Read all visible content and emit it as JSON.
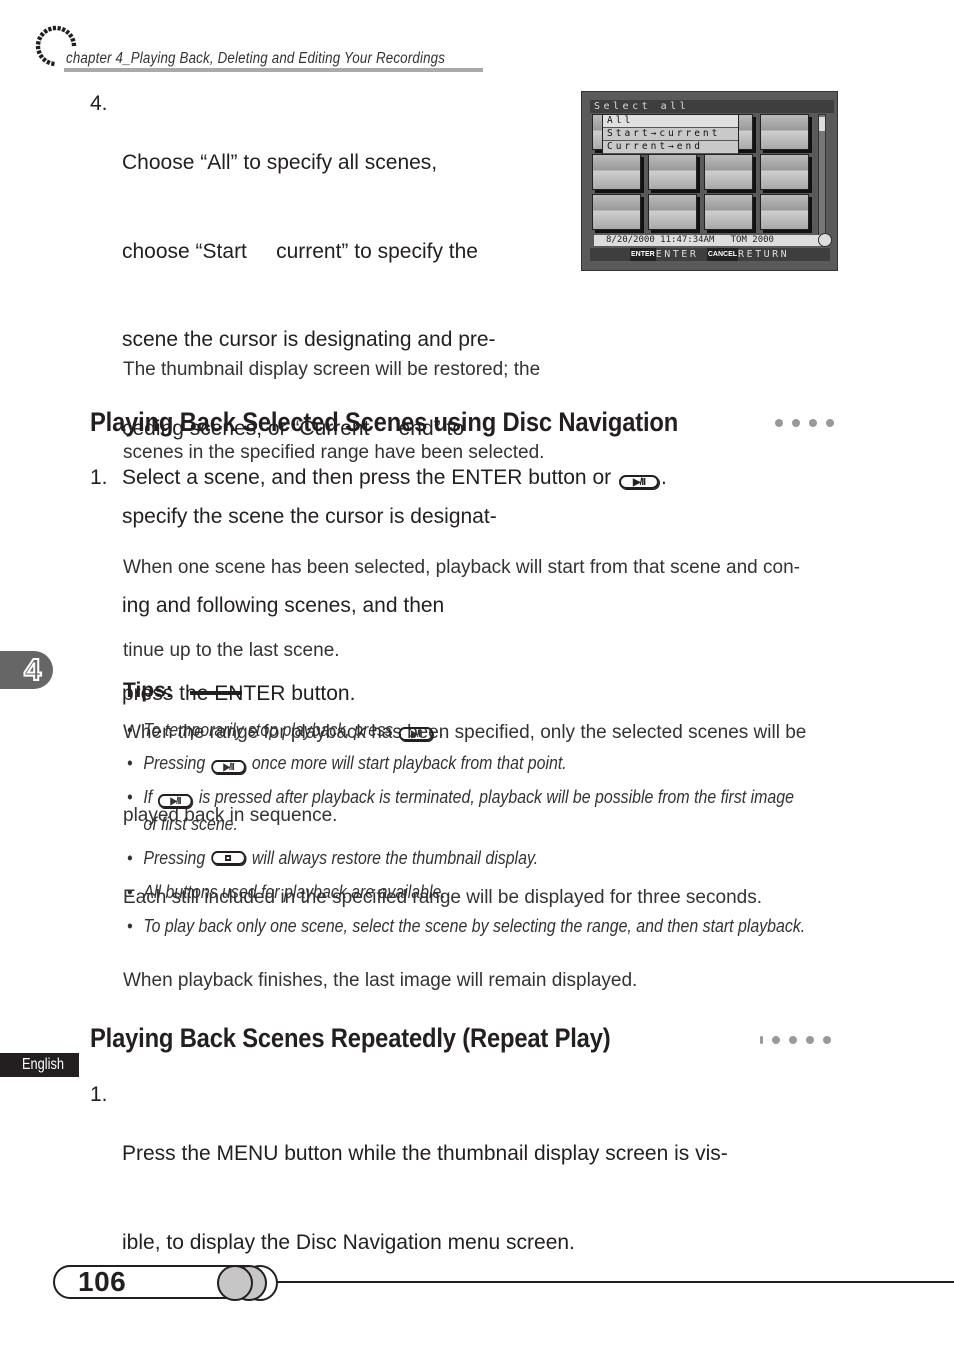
{
  "header": {
    "chapter_title": "chapter 4_Playing Back, Deleting and Editing Your Recordings"
  },
  "step4": {
    "number": "4.",
    "lines": [
      "Choose “All” to specify all scenes,",
      "choose “Start     current” to specify the",
      "scene the cursor is designating and pre-",
      "ceding scenes, or “Current     end” to",
      "specify the scene the cursor is designat-",
      "ing and following scenes, and then",
      "press the ENTER button."
    ],
    "note_lines": [
      "The thumbnail display screen will be restored; the",
      "scenes in the specified range have been selected."
    ]
  },
  "screen": {
    "title": "Select all",
    "menu_items": [
      "All",
      "Start→current",
      "Current→end"
    ],
    "selected_index": 0,
    "info": "8/20/2000 11:47:34AM   TOM 2000",
    "enter_tag": "ENTER",
    "enter_label": "ENTER",
    "cancel_tag": "CANCEL",
    "cancel_label": "RETURN"
  },
  "section1": {
    "title": "Playing Back Selected Scenes using Disc Navigation",
    "step_number": "1.",
    "step_text": "Select a scene, and then press the ENTER button or",
    "step_icon": "play-pause-button-icon",
    "body_lines": [
      "When one scene has been selected, playback will start from that scene and con-",
      "tinue up to the last scene.",
      "When the range for playback has been specified, only the selected scenes will be",
      "played back in sequence.",
      "Each still included in the specified range will be displayed for three seconds.",
      "When playback finishes, the last image will remain displayed."
    ]
  },
  "tips": {
    "label": "Tips:",
    "items": [
      {
        "before": "To temporarily stop playback, press",
        "icon": "play-pause-button-icon",
        "after": " ."
      },
      {
        "before": "Pressing",
        "icon": "play-pause-button-icon",
        "after": "once more will start playback from that point."
      },
      {
        "before": "If",
        "icon": "play-pause-button-icon",
        "after": "is pressed after playback is terminated, playback will be possible from the first image",
        "line2": "of first scene."
      },
      {
        "before": "Pressing",
        "icon": "stop-button-icon",
        "after": "will always restore the thumbnail display."
      },
      {
        "before": "All buttons used for playback are available."
      },
      {
        "before": "To play back only one scene, select the scene by selecting the range, and then start playback."
      }
    ],
    "play_pause_glyph": "▶/II"
  },
  "chapter_tab": "4",
  "language_tab": "English",
  "section2": {
    "title": "Playing Back Scenes Repeatedly (Repeat Play)",
    "step_number": "1.",
    "step_lines": [
      "Press the MENU button while the thumbnail display screen is vis-",
      "ible, to display the Disc Navigation menu screen."
    ]
  },
  "footer": {
    "page_number": "106"
  }
}
